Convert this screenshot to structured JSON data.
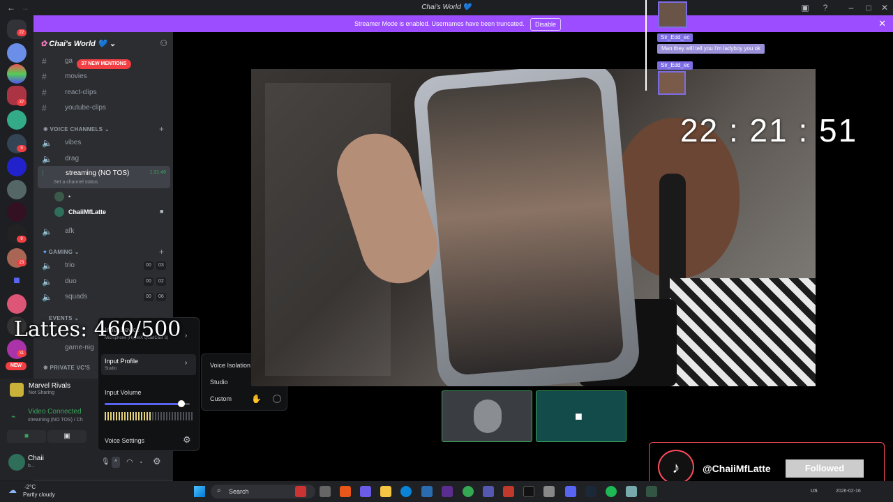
{
  "window": {
    "title": "Chai's World 💙"
  },
  "banner": {
    "message": "Streamer Mode is enabled. Usernames have been truncated.",
    "button": "Disable"
  },
  "server": {
    "name": "Chai's World 💙"
  },
  "mentions_pill": "37 NEW MENTIONS",
  "text_channels": [
    {
      "label": "ga"
    },
    {
      "label": "movies"
    },
    {
      "label": "react-clips"
    },
    {
      "label": "youtube-clips"
    }
  ],
  "voice_category": "VOICE CHANNELS",
  "voice_channels": [
    {
      "label": "vibes"
    },
    {
      "label": "drag"
    },
    {
      "label": "streaming (NO TOS)",
      "time": "1:31:46",
      "status": "Set a channel status"
    }
  ],
  "voice_users": [
    {
      "name": "•"
    },
    {
      "name": "ChaiiMfLatte"
    }
  ],
  "afk": "afk",
  "gaming_category": "GAMING",
  "gaming_channels": [
    {
      "label": "trio",
      "a": "00",
      "b": "03"
    },
    {
      "label": "duo",
      "a": "00",
      "b": "02"
    },
    {
      "label": "squads",
      "a": "00",
      "b": "06"
    }
  ],
  "events_category": "EVENTS",
  "events_channels": [
    {
      "label": "game-nig"
    }
  ],
  "private_category": "PRIVATE VC'S",
  "new_badge": "NEW",
  "guild_badges": [
    "22",
    "37",
    "9",
    "9",
    "23",
    "31",
    "9"
  ],
  "activity": {
    "game": "Marvel Rivals",
    "sub": "Not Sharing"
  },
  "connection": {
    "status": "Video Connected",
    "channel": "streaming (NO TOS) / Ch"
  },
  "user": {
    "name": "Chaii",
    "sub": "b..."
  },
  "popup": {
    "device_label": "Input Device",
    "device_value": "Microphone (HyperX QuadCast S)",
    "profile_label": "Input Profile",
    "profile_value": "Studio",
    "volume_label": "Input Volume",
    "volume_level": 0.9,
    "settings_label": "Voice Settings"
  },
  "profile_options": [
    {
      "label": "Voice Isolation",
      "selected": false
    },
    {
      "label": "Studio",
      "selected": true
    },
    {
      "label": "Custom",
      "selected": false
    }
  ],
  "overlay": {
    "lattes": "Lattes: 460/500",
    "clock": "22 : 21 : 51"
  },
  "chat": [
    {
      "name": "Sir_Edd_ec",
      "message": "Man they will tell you I'm ladyboy you ok"
    },
    {
      "name": "Sir_Edd_ec",
      "message": ""
    }
  ],
  "tiktok": {
    "handle": "@ChaiiMfLatte",
    "button": "Followed"
  },
  "taskbar": {
    "weather_temp": "-2°C",
    "weather_desc": "Partly cloudy",
    "search": "Search",
    "lang": "US",
    "date": "2026-02-16"
  },
  "colors": {
    "accent": "#5865f2",
    "banner": "#9b4dff",
    "connected": "#3ba55d"
  }
}
